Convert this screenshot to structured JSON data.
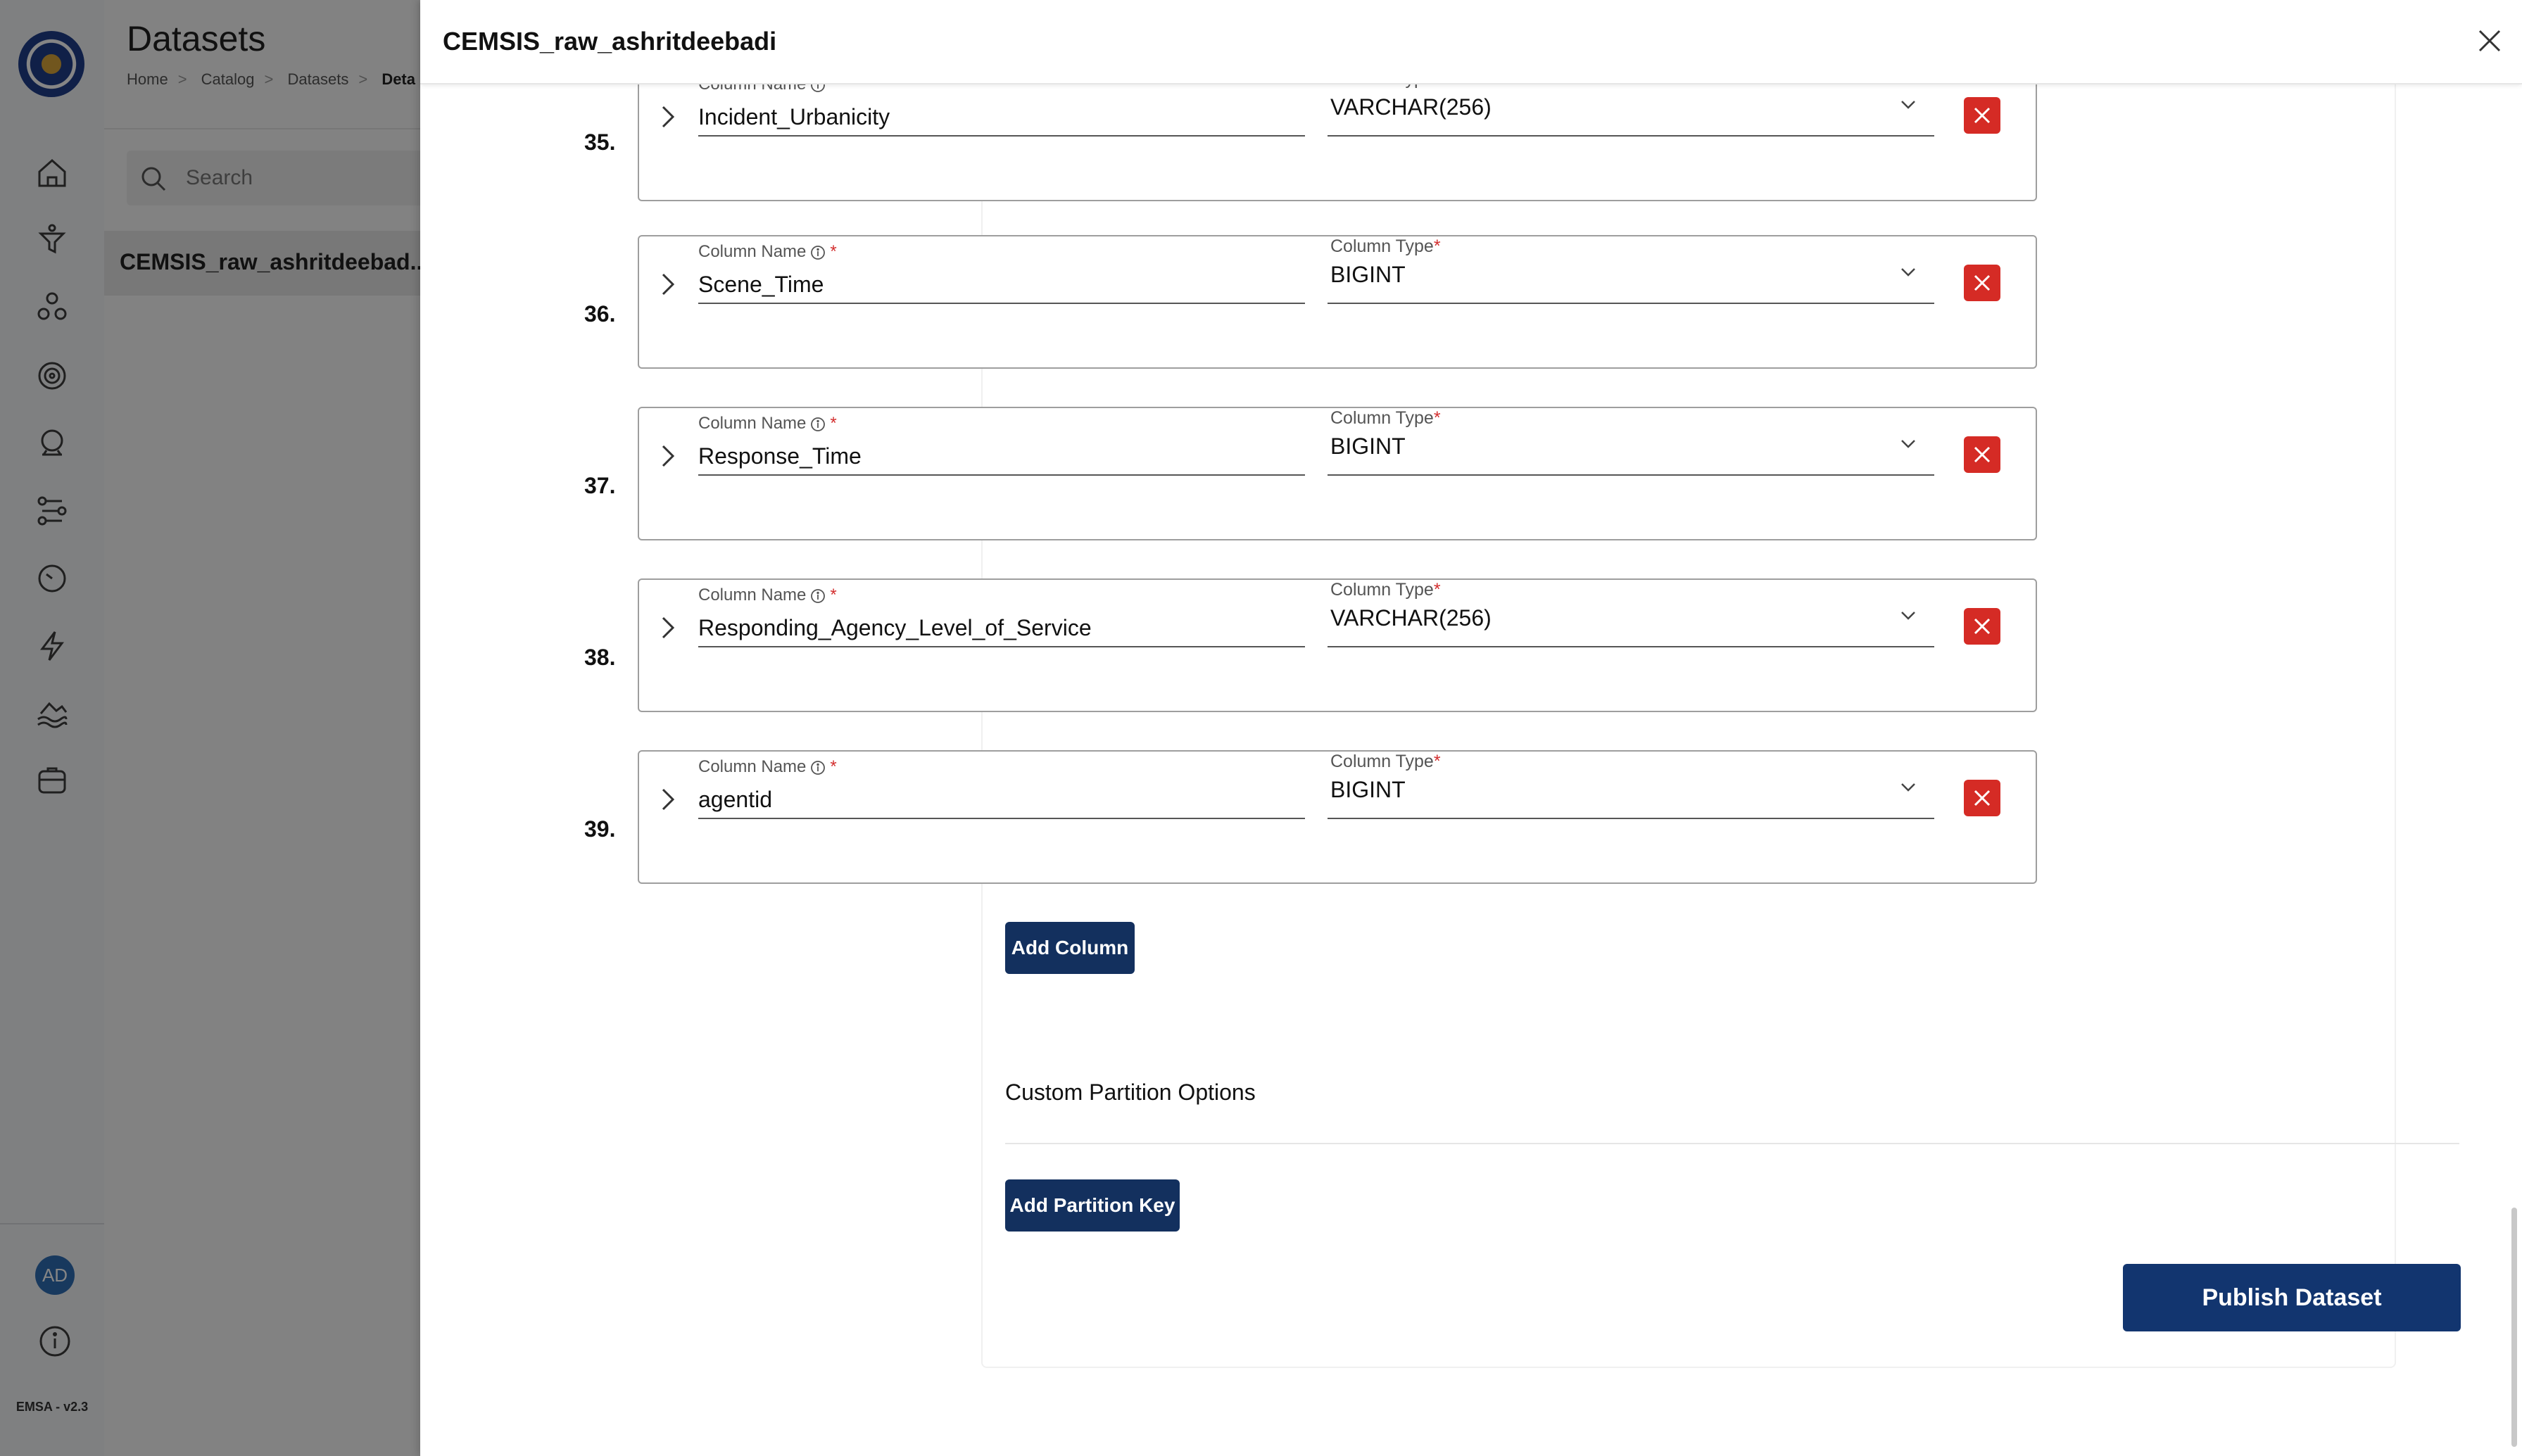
{
  "sidebar": {
    "icons": [
      "home-icon",
      "filter-funnel-icon",
      "catalog-nodes-icon",
      "settings-target-icon",
      "analysis-globe-icon",
      "pipelines-icon",
      "schedule-clock-icon",
      "lightning-icon",
      "data-lake-icon",
      "storage-database-icon"
    ],
    "avatar_initials": "AD",
    "version": "EMSA - v2.3"
  },
  "background_page": {
    "title": "Datasets",
    "breadcrumbs": [
      "Home",
      "Catalog",
      "Datasets",
      "Deta"
    ],
    "search_placeholder": "Search",
    "dataset_item": "CEMSIS_raw_ashritdeebad..."
  },
  "drawer": {
    "title": "CEMSIS_raw_ashritdeebadi",
    "columns": [
      {
        "index": "35.",
        "name_label": "Column Name",
        "name": "Incident_Urbanicity",
        "type_label": "Column Type",
        "type": "VARCHAR(256)"
      },
      {
        "index": "36.",
        "name_label": "Column Name",
        "name": "Scene_Time",
        "type_label": "Column Type",
        "type": "BIGINT"
      },
      {
        "index": "37.",
        "name_label": "Column Name",
        "name": "Response_Time",
        "type_label": "Column Type",
        "type": "BIGINT"
      },
      {
        "index": "38.",
        "name_label": "Column Name",
        "name": "Responding_Agency_Level_of_Service",
        "type_label": "Column Type",
        "type": "VARCHAR(256)"
      },
      {
        "index": "39.",
        "name_label": "Column Name",
        "name": "agentid",
        "type_label": "Column Type",
        "type": "BIGINT"
      }
    ],
    "add_column_label": "Add Column",
    "partition_section_title": "Custom Partition Options",
    "add_partition_label": "Add Partition Key",
    "publish_label": "Publish Dataset"
  },
  "colors": {
    "primary_button": "#13305e",
    "publish_button": "#12356f",
    "delete_button": "#d52b25",
    "required": "#d32f2f"
  }
}
